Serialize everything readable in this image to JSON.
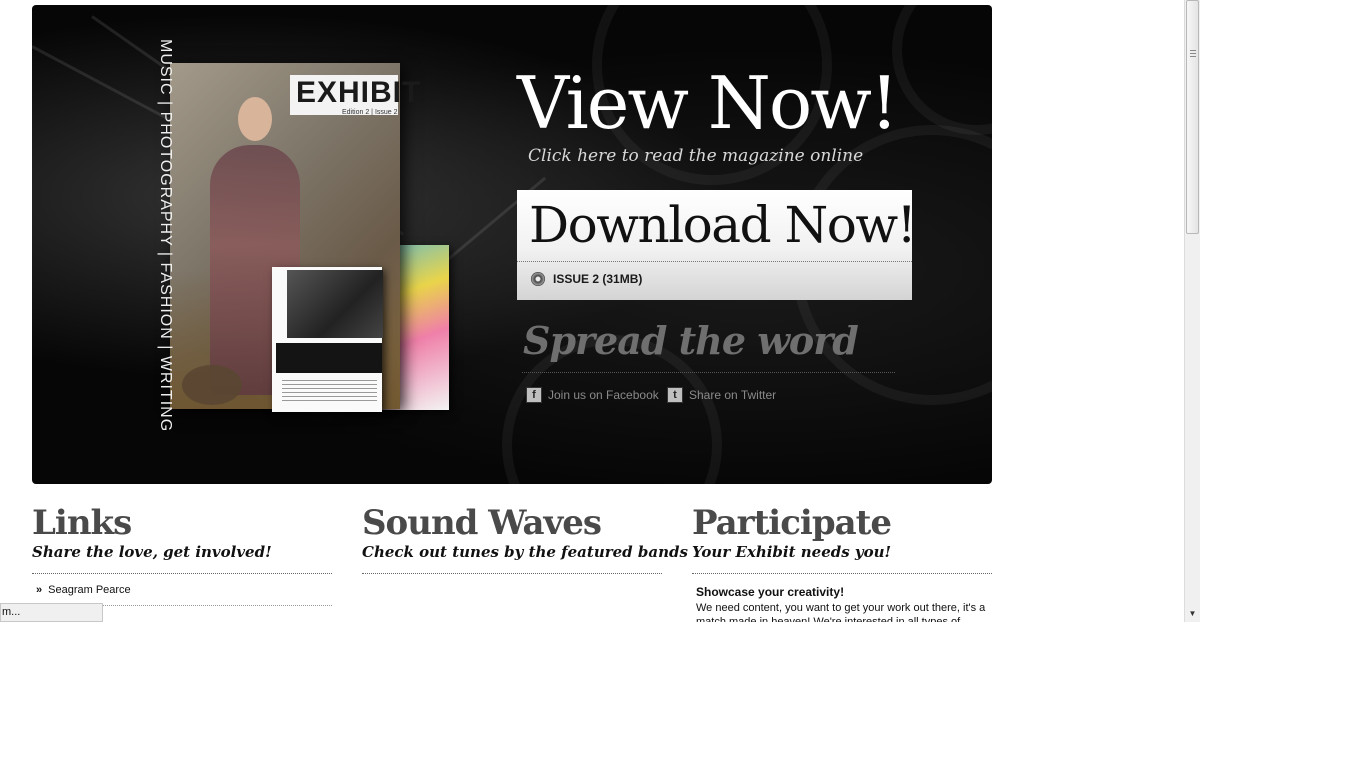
{
  "hero": {
    "cover": {
      "logo": "EXHIBIT",
      "edition": "Edition 2 | Issue 2",
      "spine": "MUSIC | PHOTOGRAPHY | FASHION | WRITING"
    },
    "view_title": "View Now!",
    "view_subtitle": "Click here to read the magazine online",
    "download_title": "Download Now!",
    "issue_label": "ISSUE 2 (31MB)",
    "spread_title": "Spread the word",
    "facebook_label": "Join us on Facebook",
    "twitter_label": "Share on Twitter",
    "facebook_icon": "facebook-icon",
    "twitter_icon": "twitter-icon"
  },
  "columns": {
    "links": {
      "title": "Links",
      "subtitle": "Share the love, get involved!",
      "items": [
        {
          "label": "Seagram Pearce"
        }
      ]
    },
    "sound": {
      "title": "Sound Waves",
      "subtitle": "Check out tunes by the featured bands"
    },
    "participate": {
      "title": "Participate",
      "subtitle": "Your Exhibit needs you!",
      "heading": "Showcase your creativity!",
      "body": "We need content, you want to get your work out there, it's a match made in heaven! We're interested in all types of"
    }
  },
  "status_bar": {
    "text": "m..."
  },
  "colors": {
    "hero_background": "#060606",
    "heading_gray": "#4a4a4a",
    "spread_gray": "#6f6f6f"
  }
}
